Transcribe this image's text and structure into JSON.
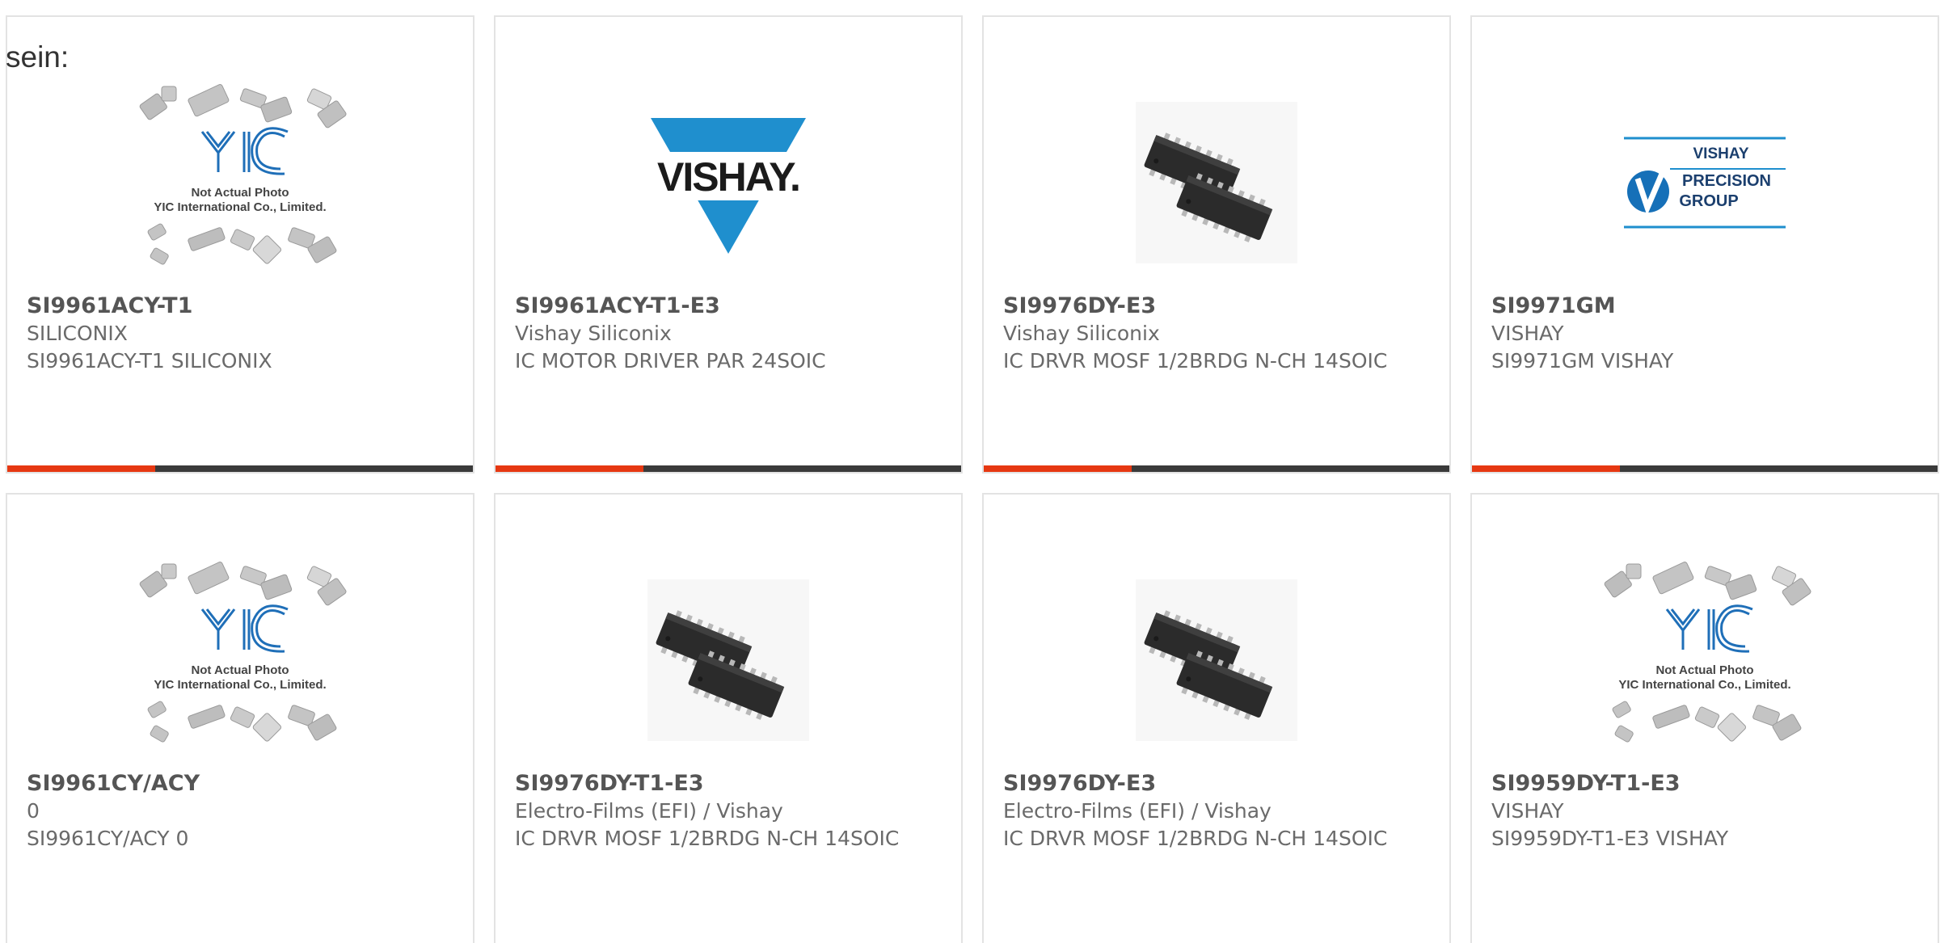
{
  "intro_text": "sein:",
  "cards": [
    {
      "part": "SI9961ACY-T1",
      "manufacturer": "SILICONIX",
      "description": "SI9961ACY-T1 SILICONIX",
      "image": "not-actual-photo",
      "photo_line1": "Not Actual Photo",
      "photo_line2": "YIC International Co., Limited.",
      "logo_text": "YIC"
    },
    {
      "part": "SI9961ACY-T1-E3",
      "manufacturer": "Vishay Siliconix",
      "description": "IC MOTOR DRIVER PAR 24SOIC",
      "image": "vishay-logo",
      "logo_text": "VISHAY."
    },
    {
      "part": "SI9976DY-E3",
      "manufacturer": "Vishay Siliconix",
      "description": "IC DRVR MOSF 1/2BRDG N-CH 14SOIC",
      "image": "soic-chips"
    },
    {
      "part": "SI9971GM",
      "manufacturer": "VISHAY",
      "description": "SI9971GM VISHAY",
      "image": "vishay-precision-logo",
      "logo_lines": [
        "VISHAY",
        "PRECISION",
        "GROUP"
      ]
    },
    {
      "part": "SI9961CY/ACY",
      "manufacturer": "0",
      "description": "SI9961CY/ACY 0",
      "image": "not-actual-photo",
      "photo_line1": "Not Actual Photo",
      "photo_line2": "YIC International Co., Limited.",
      "logo_text": "YIC"
    },
    {
      "part": "SI9976DY-T1-E3",
      "manufacturer": "Electro-Films (EFI) / Vishay",
      "description": "IC DRVR MOSF 1/2BRDG N-CH 14SOIC",
      "image": "soic-chips"
    },
    {
      "part": "SI9976DY-E3",
      "manufacturer": "Electro-Films (EFI) / Vishay",
      "description": "IC DRVR MOSF 1/2BRDG N-CH 14SOIC",
      "image": "soic-chips"
    },
    {
      "part": "SI9959DY-T1-E3",
      "manufacturer": "VISHAY",
      "description": "SI9959DY-T1-E3 VISHAY",
      "image": "not-actual-photo",
      "photo_line1": "Not Actual Photo",
      "photo_line2": "YIC International Co., Limited.",
      "logo_text": "YIC"
    }
  ],
  "colors": {
    "accent": "#e63812",
    "bar": "#3a3a3a",
    "vishay_blue": "#1f8fce",
    "yic_blue": "#1f6fb8"
  }
}
